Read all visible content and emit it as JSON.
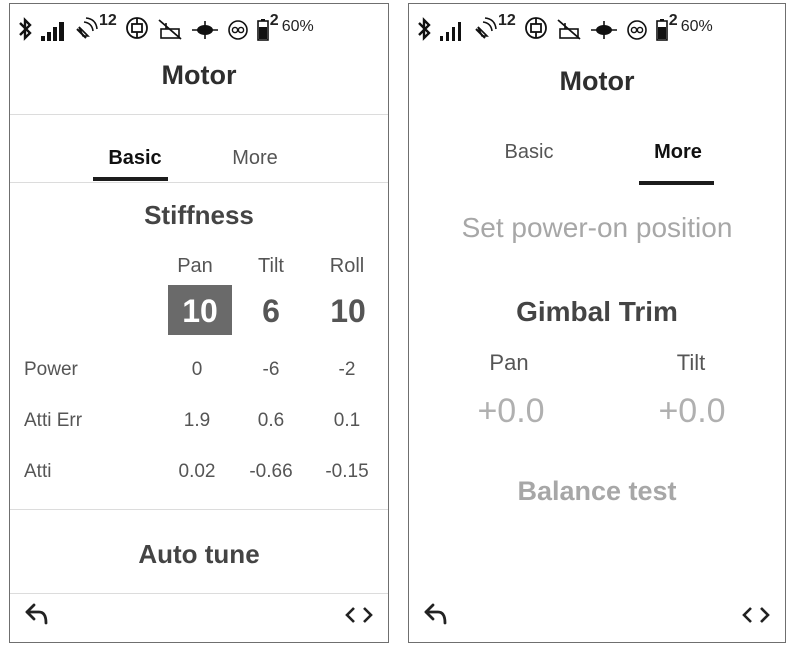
{
  "status": {
    "satellite_count": "12",
    "battery_index": "2",
    "battery_percent": "60%"
  },
  "left": {
    "title": "Motor",
    "tabs": [
      {
        "label": "Basic",
        "active": true
      },
      {
        "label": "More",
        "active": false
      }
    ],
    "stiffness_title": "Stiffness",
    "columns": [
      "Pan",
      "Tilt",
      "Roll"
    ],
    "stiffness_values": [
      "10",
      "6",
      "10"
    ],
    "rows": [
      {
        "label": "Power",
        "values": [
          "0",
          "-6",
          "-2"
        ]
      },
      {
        "label": "Atti Err",
        "values": [
          "1.9",
          "0.6",
          "0.1"
        ]
      },
      {
        "label": "Atti",
        "values": [
          "0.02",
          "-0.66",
          "-0.15"
        ]
      }
    ],
    "auto_tune_label": "Auto tune"
  },
  "right": {
    "title": "Motor",
    "tabs": [
      {
        "label": "Basic",
        "active": false
      },
      {
        "label": "More",
        "active": true
      }
    ],
    "power_on_label": "Set power-on position",
    "gimbal_trim_title": "Gimbal Trim",
    "trim": [
      {
        "label": "Pan",
        "value": "+0.0"
      },
      {
        "label": "Tilt",
        "value": "+0.0"
      }
    ],
    "balance_test_label": "Balance test"
  },
  "icons": {
    "back": "back-arrow-icon",
    "switch_screen": "left-right-chevrons-icon"
  }
}
